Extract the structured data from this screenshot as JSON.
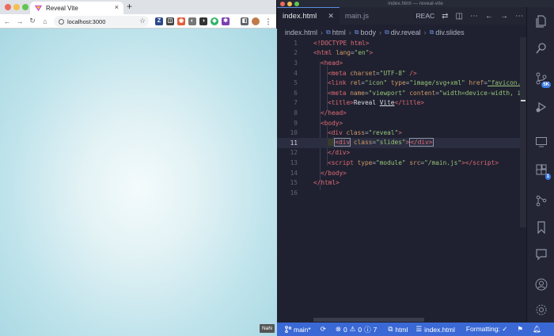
{
  "browser": {
    "tab_title": "Reveal Vite",
    "tab_close": "×",
    "new_tab": "+",
    "url": "localhost:3000",
    "nav": {
      "back": "←",
      "forward": "→",
      "reload": "↻",
      "home": "⌂"
    },
    "extensions": [
      "Z",
      "◫",
      "◉",
      "◐",
      "◑",
      "◆",
      "✱",
      "◧",
      "⋮"
    ],
    "nan_badge": "NaN"
  },
  "vscode": {
    "window_title": "index.html — reveal-vite",
    "tabs": [
      {
        "label": "index.html",
        "close": "✕"
      },
      {
        "label": "main.js"
      }
    ],
    "tab_actions": {
      "preview": "REAC",
      "icons": [
        "⇄",
        "◫",
        "⋯",
        "←",
        "→",
        "⋯"
      ]
    },
    "breadcrumb": [
      "index.html",
      "html",
      "body",
      "div.reveal",
      "div.slides"
    ],
    "lines": [
      {
        "n": "1"
      },
      {
        "n": "2"
      },
      {
        "n": "3"
      },
      {
        "n": "4"
      },
      {
        "n": "5"
      },
      {
        "n": "6"
      },
      {
        "n": "7"
      },
      {
        "n": "8"
      },
      {
        "n": "9"
      },
      {
        "n": "10"
      },
      {
        "n": "11"
      },
      {
        "n": "12"
      },
      {
        "n": "13"
      },
      {
        "n": "14"
      },
      {
        "n": "15"
      },
      {
        "n": "16"
      }
    ],
    "code": {
      "l1": "<!DOCTYPE html>",
      "l2_tag": "<html",
      "l2_attr": "lang",
      "l2_val": "\"en\"",
      "l2_end": ">",
      "l3": "<head>",
      "l4_tag": "<meta",
      "l4_attr": "charset",
      "l4_val": "\"UTF-8\"",
      "l4_end": " />",
      "l5_tag": "<link",
      "l5_a1": "rel",
      "l5_v1": "\"icon\"",
      "l5_a2": "type",
      "l5_v2": "\"image/svg+xml\"",
      "l5_a3": "href",
      "l5_v3": "\"favicon.svg",
      "l6_tag": "<meta",
      "l6_a1": "name",
      "l6_v1": "\"viewport\"",
      "l6_a2": "content",
      "l6_v2": "\"width=device-width, init",
      "l7_open": "<title>",
      "l7_text": "Reveal ",
      "l7_text2": "Vite",
      "l7_close": "</title>",
      "l8": "</head>",
      "l9": "<body>",
      "l10_tag": "<div",
      "l10_attr": "class",
      "l10_val": "\"reveal\"",
      "l10_end": ">",
      "l11_tag": "<div",
      "l11_attr": "class",
      "l11_val": "\"slides\"",
      "l11_end": ">",
      "l11_close": "</div>",
      "l12": "</div>",
      "l13_tag": "<script",
      "l13_a1": "type",
      "l13_v1": "\"module\"",
      "l13_a2": "src",
      "l13_v2": "\"/main.js\"",
      "l13_end": "></",
      "l13_close": "script>",
      "l14": "</body>",
      "l15": "</html>"
    },
    "status": {
      "branch": "main*",
      "sync": "⟳",
      "errors": "0",
      "warnings": "0",
      "info": "7",
      "language_crumb": "html",
      "file_crumb": "index.html",
      "formatting": "Formatting: ✓"
    },
    "activity_badges": {
      "scm": "5K",
      "extensions": "1"
    }
  },
  "colors": {
    "status_bar": "#3a69d6",
    "editor_bg": "#1f2130",
    "accent": "#5a8de0"
  }
}
